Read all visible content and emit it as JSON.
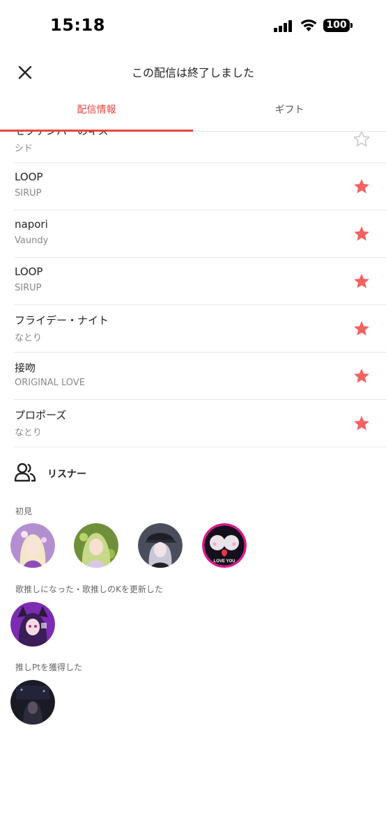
{
  "status": {
    "time": "15:18",
    "battery": "100"
  },
  "nav": {
    "title": "この配信は終了しました",
    "close_icon": "close-icon"
  },
  "tabs": [
    {
      "label": "配信情報",
      "active": true
    },
    {
      "label": "ギフト",
      "active": false
    }
  ],
  "songs": [
    {
      "title": "セプテンバーのキス",
      "artist": "シド",
      "favorited": false
    },
    {
      "title": "LOOP",
      "artist": "SIRUP",
      "favorited": true
    },
    {
      "title": "napori",
      "artist": "Vaundy",
      "favorited": true
    },
    {
      "title": "LOOP",
      "artist": "SIRUP",
      "favorited": true
    },
    {
      "title": "フライデー・ナイト",
      "artist": "なとり",
      "favorited": true
    },
    {
      "title": "接吻",
      "artist": "ORIGINAL LOVE",
      "favorited": true
    },
    {
      "title": "プロポーズ",
      "artist": "なとり",
      "favorited": true
    }
  ],
  "listeners": {
    "label": "リスナー",
    "sections": [
      {
        "label": "初見",
        "avatar_count": 4
      },
      {
        "label": "歌推しになった・歌推しのKを更新した",
        "avatar_count": 1
      },
      {
        "label": "推しPtを獲得した",
        "avatar_count": 1
      }
    ],
    "badge_text": "LOVE YOU"
  },
  "colors": {
    "accent": "#e8443f",
    "star_filled": "#f26363",
    "star_empty": "#c8c8c8"
  }
}
